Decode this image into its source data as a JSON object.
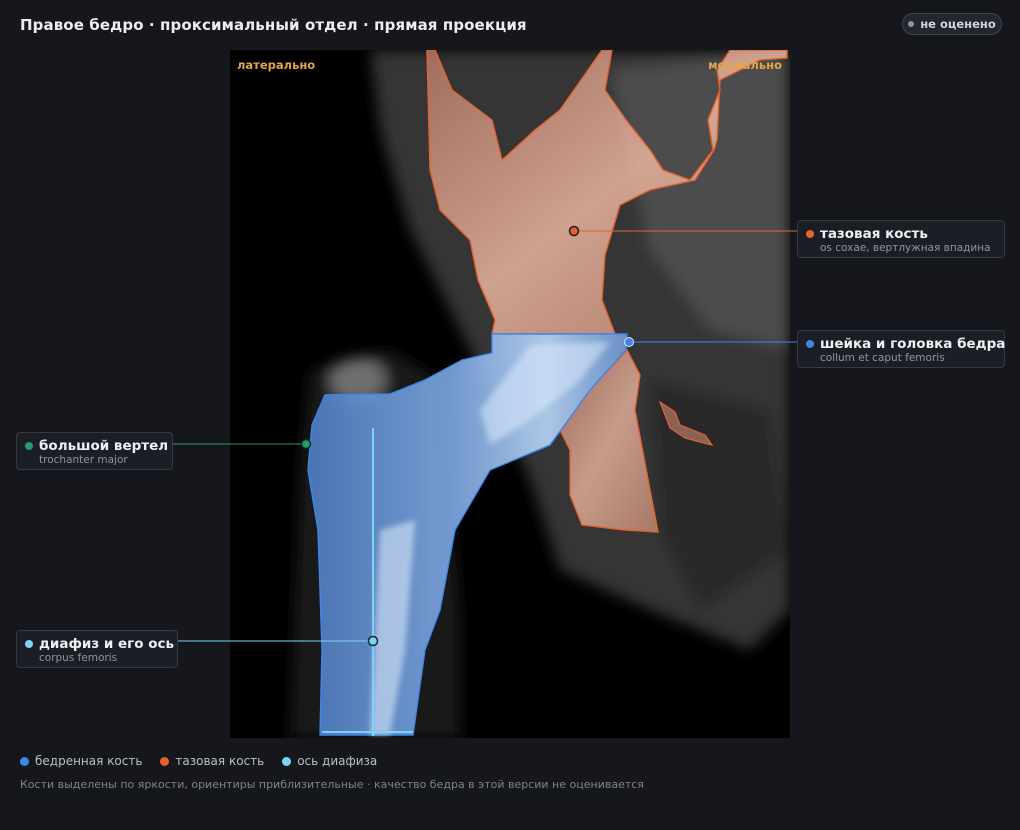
{
  "header": {
    "title": "Правое бедро · проксимальный отдел · прямая проекция",
    "status_badge": "не оценено"
  },
  "image": {
    "orientation_left": "латерально",
    "orientation_right": "медиально"
  },
  "annotations": [
    {
      "id": "pelvis",
      "name": "тазовая кость",
      "latin": "os coxae, вертлужная впадина",
      "color": "#e4622f"
    },
    {
      "id": "neck",
      "name": "шейка и головка бедра",
      "latin": "collum et caput femoris",
      "color": "#3f86e8"
    },
    {
      "id": "trochanter",
      "name": "большой вертел",
      "latin": "trochanter major",
      "color": "#1f9e6f"
    },
    {
      "id": "shaft",
      "name": "диафиз и его ось",
      "latin": "corpus femoris",
      "color": "#7fd3f2"
    }
  ],
  "legend": [
    {
      "label": "бедренная кость",
      "color": "#3f86e8"
    },
    {
      "label": "тазовая кость",
      "color": "#e4622f"
    },
    {
      "label": "ось диафиза",
      "color": "#7fd3f2"
    }
  ],
  "footnote": "Кости выделены по яркости, ориентиры приблизительные · качество бедра в этой версии не оценивается"
}
